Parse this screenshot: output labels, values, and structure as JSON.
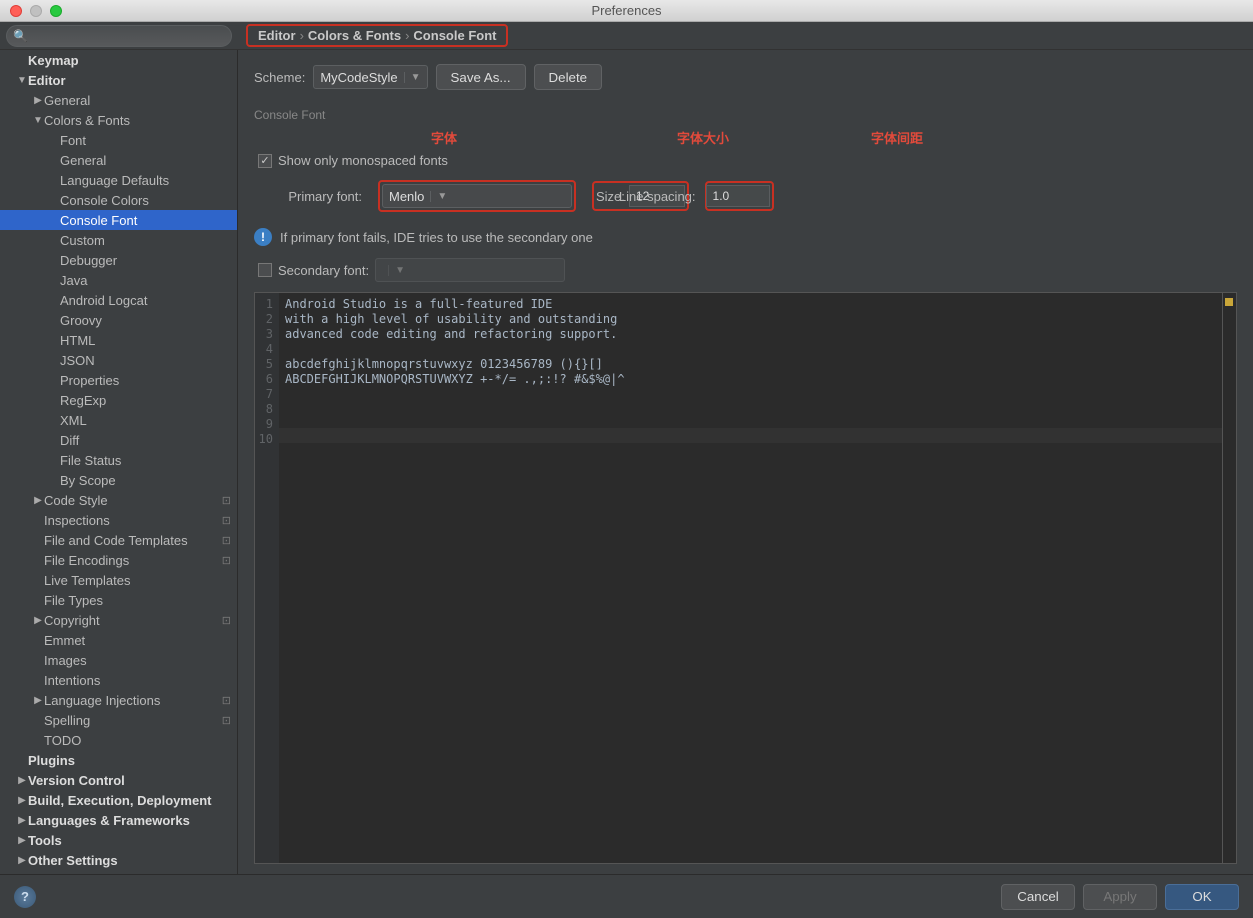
{
  "window": {
    "title": "Preferences"
  },
  "search": {
    "placeholder": ""
  },
  "breadcrumb": {
    "a": "Editor",
    "b": "Colors & Fonts",
    "c": "Console Font"
  },
  "scheme": {
    "label": "Scheme:",
    "value": "MyCodeStyle",
    "saveAs": "Save As...",
    "delete": "Delete"
  },
  "section": {
    "consoleFont": "Console Font"
  },
  "annot": {
    "font": "字体",
    "size": "字体大小",
    "spacing": "字体间距"
  },
  "check": {
    "monospaced": "Show only monospaced fonts"
  },
  "primary": {
    "label": "Primary font:",
    "value": "Menlo"
  },
  "size": {
    "label": "Size:",
    "value": "12"
  },
  "spacing": {
    "label": "Line spacing:",
    "value": "1.0"
  },
  "info": {
    "text": "If primary font fails, IDE tries to use the secondary one"
  },
  "secondary": {
    "label": "Secondary font:",
    "value": ""
  },
  "preview": {
    "lines": [
      "Android Studio is a full-featured IDE",
      "with a high level of usability and outstanding",
      "advanced code editing and refactoring support.",
      "",
      "abcdefghijklmnopqrstuvwxyz 0123456789 (){}[]",
      "ABCDEFGHIJKLMNOPQRSTUVWXYZ +-*/= .,;:!? #&$%@|^",
      "",
      "",
      "",
      ""
    ]
  },
  "buttons": {
    "cancel": "Cancel",
    "apply": "Apply",
    "ok": "OK"
  },
  "tree": [
    {
      "label": "Keymap",
      "depth": 1,
      "arrow": "none",
      "bold": true
    },
    {
      "label": "Editor",
      "depth": 1,
      "arrow": "down",
      "bold": true
    },
    {
      "label": "General",
      "depth": 2,
      "arrow": "right"
    },
    {
      "label": "Colors & Fonts",
      "depth": 2,
      "arrow": "down"
    },
    {
      "label": "Font",
      "depth": 3,
      "arrow": "none"
    },
    {
      "label": "General",
      "depth": 3,
      "arrow": "none"
    },
    {
      "label": "Language Defaults",
      "depth": 3,
      "arrow": "none"
    },
    {
      "label": "Console Colors",
      "depth": 3,
      "arrow": "none"
    },
    {
      "label": "Console Font",
      "depth": 3,
      "arrow": "none",
      "selected": true
    },
    {
      "label": "Custom",
      "depth": 3,
      "arrow": "none"
    },
    {
      "label": "Debugger",
      "depth": 3,
      "arrow": "none"
    },
    {
      "label": "Java",
      "depth": 3,
      "arrow": "none"
    },
    {
      "label": "Android Logcat",
      "depth": 3,
      "arrow": "none"
    },
    {
      "label": "Groovy",
      "depth": 3,
      "arrow": "none"
    },
    {
      "label": "HTML",
      "depth": 3,
      "arrow": "none"
    },
    {
      "label": "JSON",
      "depth": 3,
      "arrow": "none"
    },
    {
      "label": "Properties",
      "depth": 3,
      "arrow": "none"
    },
    {
      "label": "RegExp",
      "depth": 3,
      "arrow": "none"
    },
    {
      "label": "XML",
      "depth": 3,
      "arrow": "none"
    },
    {
      "label": "Diff",
      "depth": 3,
      "arrow": "none"
    },
    {
      "label": "File Status",
      "depth": 3,
      "arrow": "none"
    },
    {
      "label": "By Scope",
      "depth": 3,
      "arrow": "none"
    },
    {
      "label": "Code Style",
      "depth": 2,
      "arrow": "right",
      "cfg": true
    },
    {
      "label": "Inspections",
      "depth": 2,
      "arrow": "none",
      "cfg": true
    },
    {
      "label": "File and Code Templates",
      "depth": 2,
      "arrow": "none",
      "cfg": true
    },
    {
      "label": "File Encodings",
      "depth": 2,
      "arrow": "none",
      "cfg": true
    },
    {
      "label": "Live Templates",
      "depth": 2,
      "arrow": "none"
    },
    {
      "label": "File Types",
      "depth": 2,
      "arrow": "none"
    },
    {
      "label": "Copyright",
      "depth": 2,
      "arrow": "right",
      "cfg": true
    },
    {
      "label": "Emmet",
      "depth": 2,
      "arrow": "none"
    },
    {
      "label": "Images",
      "depth": 2,
      "arrow": "none"
    },
    {
      "label": "Intentions",
      "depth": 2,
      "arrow": "none"
    },
    {
      "label": "Language Injections",
      "depth": 2,
      "arrow": "right",
      "cfg": true
    },
    {
      "label": "Spelling",
      "depth": 2,
      "arrow": "none",
      "cfg": true
    },
    {
      "label": "TODO",
      "depth": 2,
      "arrow": "none"
    },
    {
      "label": "Plugins",
      "depth": 1,
      "arrow": "none",
      "bold": true
    },
    {
      "label": "Version Control",
      "depth": 1,
      "arrow": "right",
      "bold": true
    },
    {
      "label": "Build, Execution, Deployment",
      "depth": 1,
      "arrow": "right",
      "bold": true
    },
    {
      "label": "Languages & Frameworks",
      "depth": 1,
      "arrow": "right",
      "bold": true
    },
    {
      "label": "Tools",
      "depth": 1,
      "arrow": "right",
      "bold": true
    },
    {
      "label": "Other Settings",
      "depth": 1,
      "arrow": "right",
      "bold": true
    }
  ]
}
